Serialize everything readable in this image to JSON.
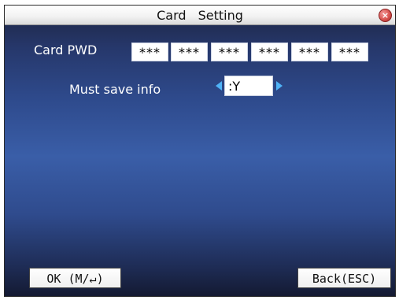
{
  "window": {
    "title": "Card  Setting",
    "close_icon": "close-icon"
  },
  "card_pwd": {
    "label": "Card  PWD",
    "boxes": [
      "***",
      "***",
      "***",
      "***",
      "***",
      "***"
    ]
  },
  "must_save_info": {
    "label": "Must  save  info",
    "value": ":Y",
    "left_arrow_icon": "arrow-left-icon",
    "right_arrow_icon": "arrow-right-icon"
  },
  "buttons": {
    "ok_label": "OK (M/↵)",
    "back_label": "Back(ESC)"
  },
  "colors": {
    "accent_arrow": "#4fb3f7",
    "close_red": "#d9534f"
  }
}
